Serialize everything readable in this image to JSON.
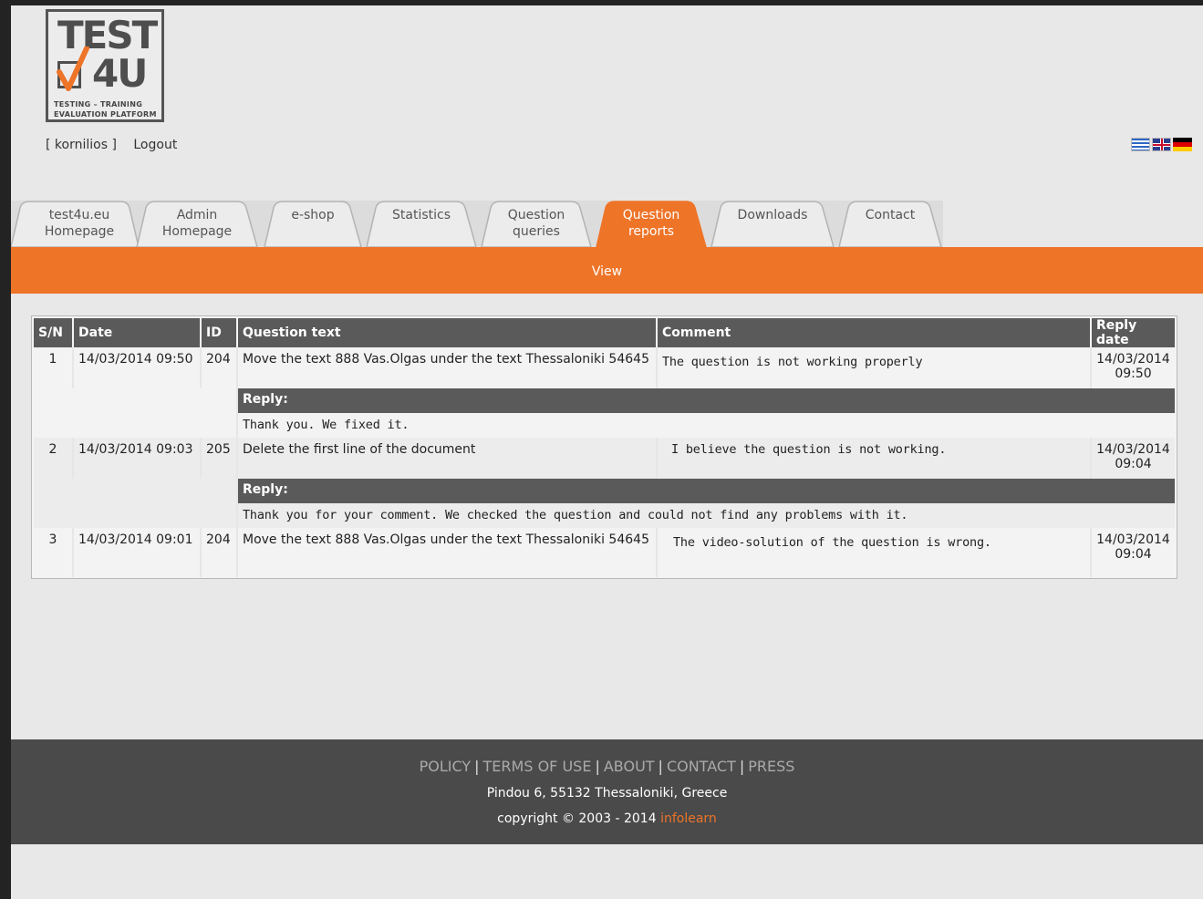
{
  "logo": {
    "line1": "TEST",
    "line2": "4U",
    "tagline1": "TESTING – TRAINING",
    "tagline2": "EVALUATION PLATFORM"
  },
  "user": {
    "username": "[ kornilios ]",
    "logout": "Logout"
  },
  "flags": [
    "greek-flag",
    "uk-flag",
    "german-flag"
  ],
  "tabs": [
    {
      "label": "test4u.eu\nHomepage"
    },
    {
      "label": "Admin\nHomepage"
    },
    {
      "label": "e-shop"
    },
    {
      "label": "Statistics"
    },
    {
      "label": "Question\nqueries"
    },
    {
      "label": "Question\nreports",
      "active": true
    },
    {
      "label": "Downloads"
    },
    {
      "label": "Contact"
    }
  ],
  "subnav": {
    "view": "View"
  },
  "table": {
    "headers": [
      "S/N",
      "Date",
      "ID",
      "Question text",
      "Comment",
      "Reply date"
    ],
    "reply_label": "Reply:",
    "rows": [
      {
        "sn": "1",
        "date": "14/03/2014 09:50",
        "id": "204",
        "question": "Move the text 888 Vas.Olgas under the text Thessaloniki 54645",
        "comment": "The question is not working properly",
        "reply_date": "14/03/2014 09:50",
        "reply": "Thank you. We fixed it."
      },
      {
        "sn": "2",
        "date": "14/03/2014 09:03",
        "id": "205",
        "question": "Delete the first line of the document",
        "comment": "I believe the question is not working.",
        "reply_date": "14/03/2014 09:04",
        "reply": "Thank you for your comment. We checked the question and could not find any problems with it."
      },
      {
        "sn": "3",
        "date": "14/03/2014 09:01",
        "id": "204",
        "question": "Move the text 888 Vas.Olgas under the text Thessaloniki 54645",
        "comment": "The video-solution of the question is wrong.",
        "reply_date": "14/03/2014 09:04"
      }
    ]
  },
  "footer": {
    "links": [
      "POLICY",
      "TERMS OF USE",
      "ABOUT",
      "CONTACT",
      "PRESS"
    ],
    "separator": "|",
    "address": "Pindou 6, 55132 Thessaloniki, Greece",
    "copyright": "copyright © 2003 - 2014",
    "brand": "infolearn"
  },
  "colors": {
    "accent": "#ee7428",
    "header_dark": "#5a5a5a",
    "footer_bg": "#4a4a4a"
  }
}
